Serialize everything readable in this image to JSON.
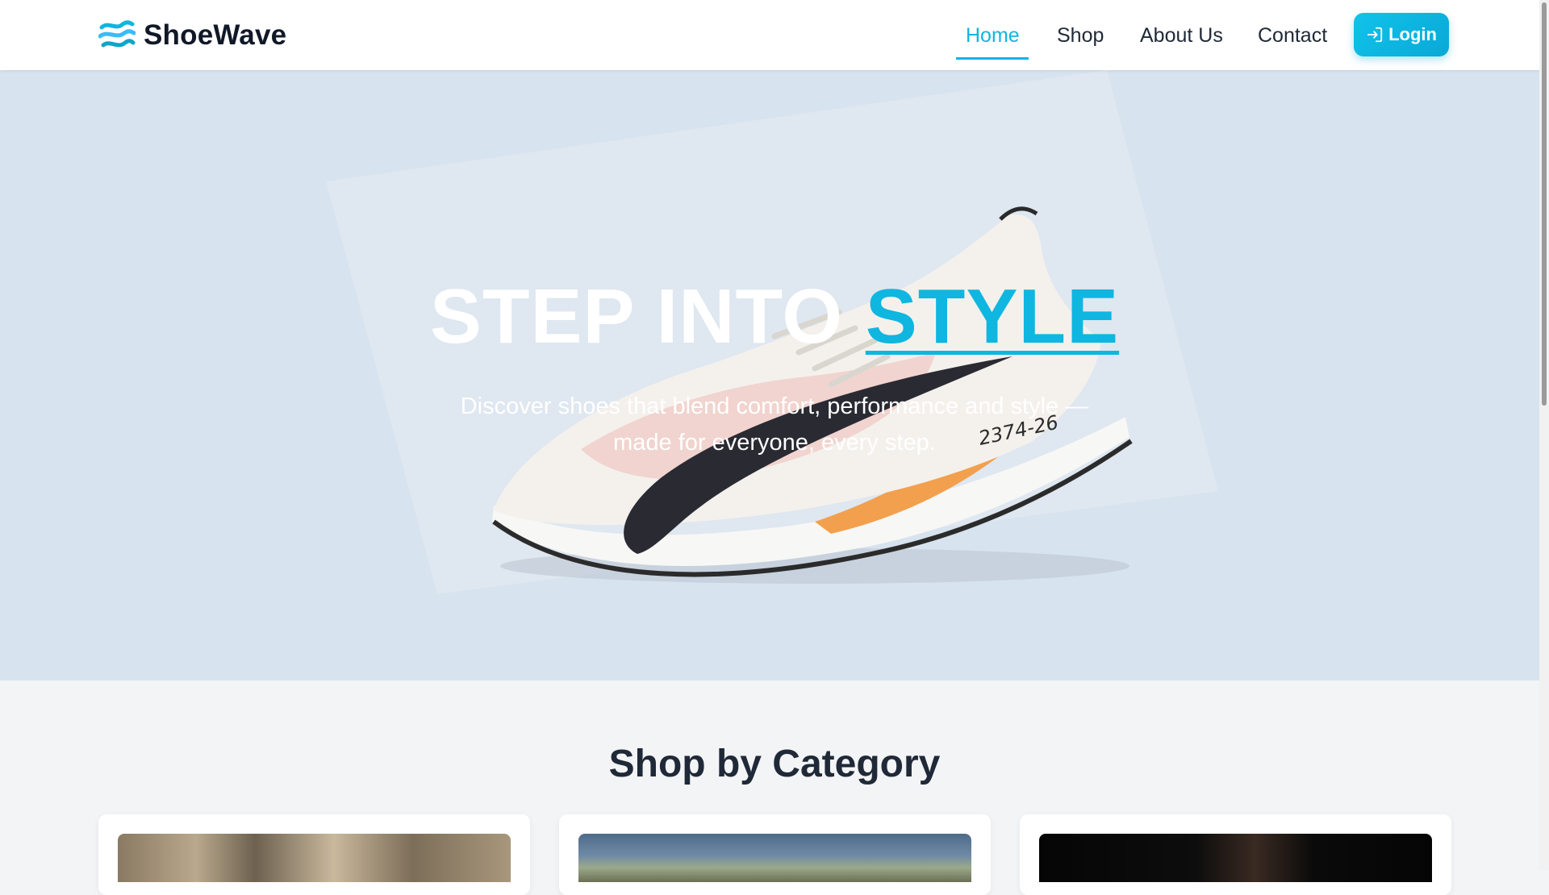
{
  "header": {
    "brand": "ShoeWave",
    "nav": [
      {
        "label": "Home",
        "active": true
      },
      {
        "label": "Shop",
        "active": false
      },
      {
        "label": "About Us",
        "active": false
      },
      {
        "label": "Contact",
        "active": false
      }
    ],
    "login_label": "Login",
    "accent_color": "#0fb6e0"
  },
  "hero": {
    "title_main": "STEP INTO ",
    "title_accent": "STYLE",
    "subtitle": "Discover shoes that blend comfort, performance and style — made for everyone, every step.",
    "shoe_tag": "2374-26",
    "background": "#d7e3ef"
  },
  "categories": {
    "title": "Shop by Category"
  },
  "icons": {
    "logo": "wave-logo-icon",
    "login": "login-arrow-icon"
  }
}
